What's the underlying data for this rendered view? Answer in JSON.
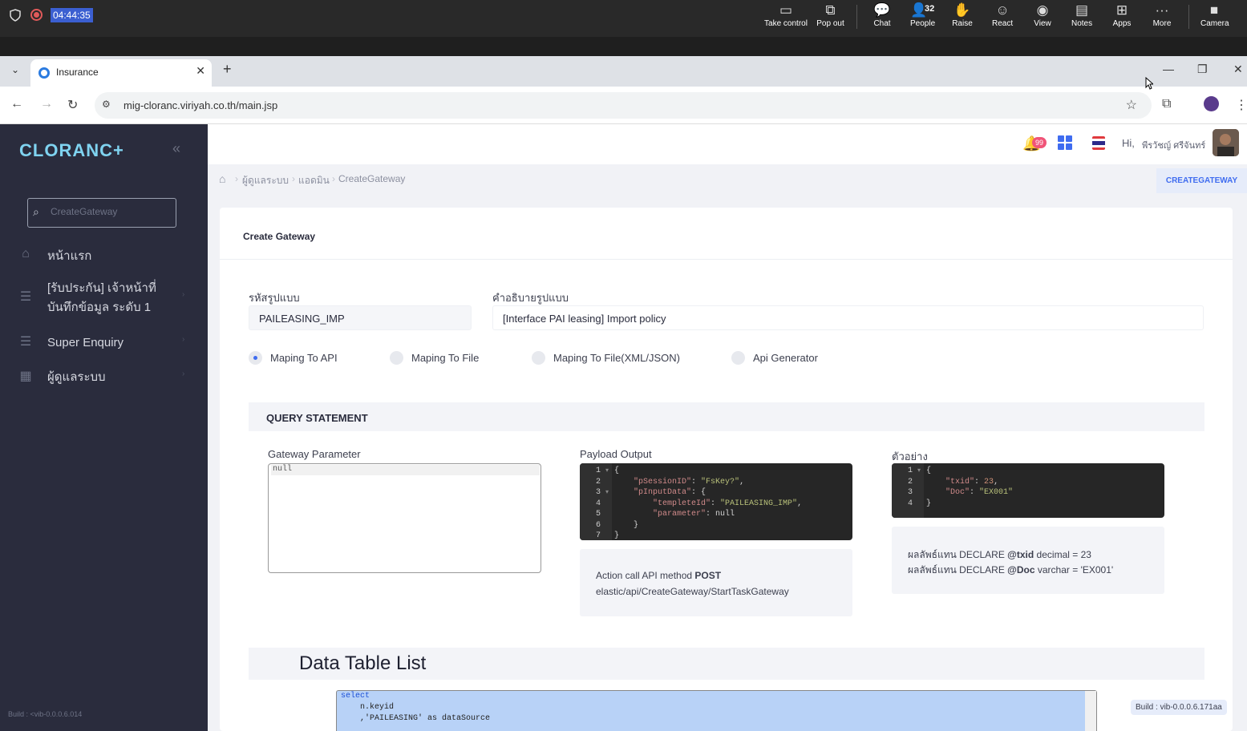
{
  "teams": {
    "timer": "04:44:35",
    "buttons": [
      {
        "label": "Take control",
        "icon": "take-control-icon",
        "glyph": "▭"
      },
      {
        "label": "Pop out",
        "icon": "pop-out-icon",
        "glyph": "⧉"
      },
      {
        "label": "Chat",
        "icon": "chat-icon",
        "glyph": "💬"
      },
      {
        "label": "People",
        "icon": "people-icon",
        "glyph": "👤"
      },
      {
        "label": "Raise",
        "icon": "raise-hand-icon",
        "glyph": "✋"
      },
      {
        "label": "React",
        "icon": "react-icon",
        "glyph": "☺"
      },
      {
        "label": "View",
        "icon": "view-icon",
        "glyph": "◉"
      },
      {
        "label": "Notes",
        "icon": "notes-icon",
        "glyph": "▤"
      },
      {
        "label": "Apps",
        "icon": "apps-icon",
        "glyph": "⊞"
      },
      {
        "label": "More",
        "icon": "more-icon",
        "glyph": "···"
      },
      {
        "label": "Camera",
        "icon": "camera-icon",
        "glyph": "■"
      }
    ],
    "people_count": "32"
  },
  "browser": {
    "tab_title": "Insurance",
    "url": "mig-cloranc.viriyah.co.th/main.jsp"
  },
  "sidebar": {
    "logo": "CLORANC+",
    "search_placeholder": "CreateGateway",
    "items": [
      {
        "label": "หน้าแรก",
        "icon": "home-icon",
        "glyph": "⌂"
      },
      {
        "label": "[รับประกัน] เจ้าหน้าที่บันทึกข้อมูล ระดับ 1",
        "icon": "list-icon",
        "glyph": "☰"
      },
      {
        "label": "Super Enquiry",
        "icon": "list-icon",
        "glyph": "☰"
      },
      {
        "label": "ผู้ดูแลระบบ",
        "icon": "grid-icon",
        "glyph": "▦"
      }
    ],
    "build": "Build : <vib-0.0.0.6.014"
  },
  "topbar": {
    "notifications": "99",
    "hi": "Hi,",
    "user_name": "พีรวัชญ์ ศรีจันทร์"
  },
  "breadcrumb": {
    "items": [
      "ผู้ดูแลระบบ",
      "แอดมิน",
      "CreateGateway"
    ],
    "button": "CREATEGATEWAY"
  },
  "form": {
    "title": "Create Gateway",
    "code_label": "รหัสรูปแบบ",
    "code_value": "PAILEASING_IMP",
    "desc_label": "คำอธิบายรูปแบบ",
    "desc_value": "[Interface PAI leasing] Import policy",
    "modes": [
      {
        "label": "Maping To API",
        "checked": true
      },
      {
        "label": "Maping To File",
        "checked": false
      },
      {
        "label": "Maping To File(XML/JSON)",
        "checked": false
      },
      {
        "label": "Api Generator",
        "checked": false
      }
    ]
  },
  "query": {
    "title": "QUERY STATEMENT",
    "gateway_label": "Gateway Parameter",
    "gateway_value": "null",
    "payload_label": "Payload Output",
    "payload_lines": [
      {
        "n": "1",
        "fold": "▾",
        "text": "{"
      },
      {
        "n": "2",
        "fold": "",
        "text": "    \"pSessionID\": \"FsKey?\","
      },
      {
        "n": "3",
        "fold": "▾",
        "text": "    \"pInputData\": {"
      },
      {
        "n": "4",
        "fold": "",
        "text": "        \"templeteId\": \"PAILEASING_IMP\","
      },
      {
        "n": "5",
        "fold": "",
        "text": "        \"parameter\": null"
      },
      {
        "n": "6",
        "fold": "",
        "text": "    }"
      },
      {
        "n": "7",
        "fold": "",
        "text": "}"
      }
    ],
    "payload_note_prefix": "Action call API method ",
    "payload_note_method": "POST",
    "payload_note_path": "elastic/api/CreateGateway/StartTaskGateway",
    "example_label": "ตัวอย่าง",
    "example_lines": [
      {
        "n": "1",
        "fold": "▾",
        "text": "{"
      },
      {
        "n": "2",
        "fold": "",
        "text": "    \"txid\": 23,"
      },
      {
        "n": "3",
        "fold": "",
        "text": "    \"Doc\": \"EX001\""
      },
      {
        "n": "4",
        "fold": "",
        "text": "}"
      }
    ],
    "example_note_1a": "ผลลัพธ์แทน DECLARE ",
    "example_note_1b": "@txid",
    "example_note_1c": " decimal = 23",
    "example_note_2a": "ผลลัพธ์แทน DECLARE ",
    "example_note_2b": "@Doc",
    "example_note_2c": " varchar = 'EX001'"
  },
  "datatable": {
    "title": "Data Table List",
    "sql_lines": [
      "select",
      "    n.keyid",
      "    ,'PAILEASING' as dataSource"
    ]
  },
  "build_right": "Build : vib-0.0.0.6.171aa"
}
